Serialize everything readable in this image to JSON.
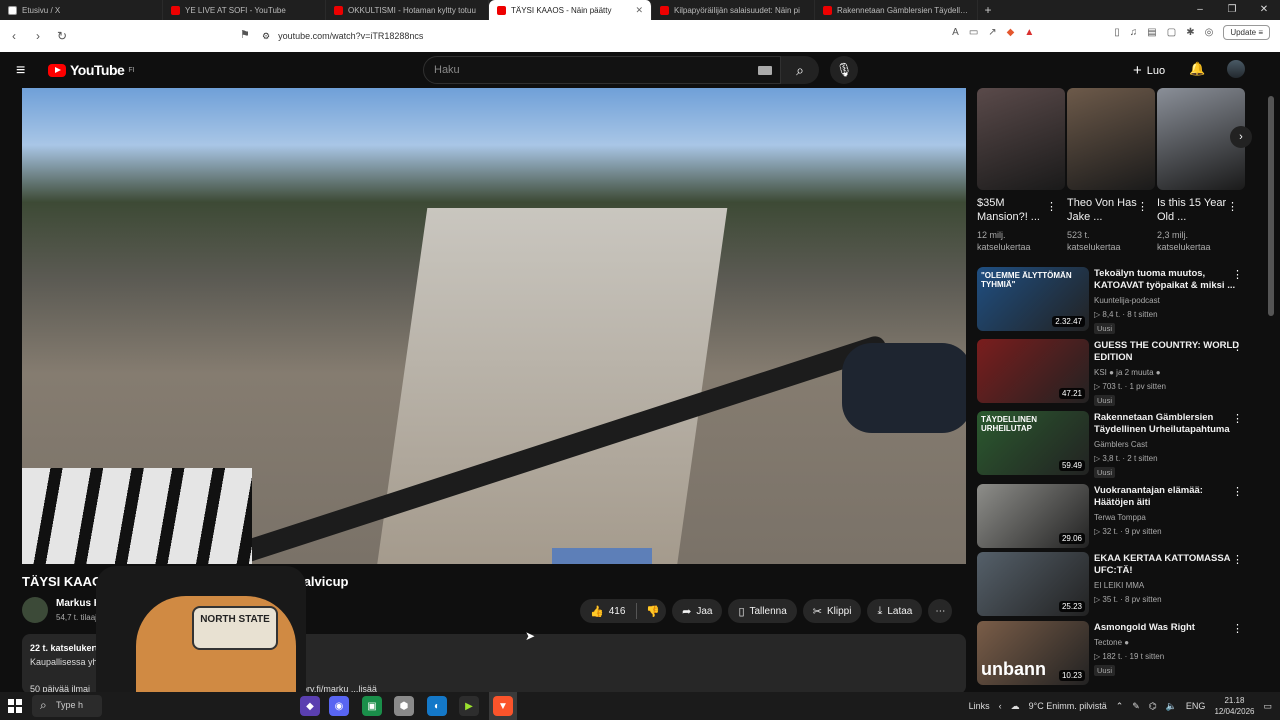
{
  "browser": {
    "tabs": [
      {
        "label": "Etusivu / X",
        "active": false,
        "icon": "x-icon"
      },
      {
        "label": "YE LIVE AT SOFI - YouTube",
        "active": false,
        "icon": "youtube-icon"
      },
      {
        "label": "OKKULTISMI - Hotaman kyltty totuu",
        "active": false,
        "icon": "youtube-icon"
      },
      {
        "label": "TÄYSI KAAOS - Näin päätty",
        "active": true,
        "icon": "youtube-icon"
      },
      {
        "label": "Kilpapyöräilijän salaisuudet: Näin pi",
        "active": false,
        "icon": "youtube-icon"
      },
      {
        "label": "Rakennetaan Gämblersien Täydelline",
        "active": false,
        "icon": "youtube-icon"
      }
    ],
    "new_tab": "+",
    "url": "youtube.com/watch?v=iTR18288ncs",
    "update_label": "Update"
  },
  "yt_header": {
    "logo_text": "YouTube",
    "region": "FI",
    "search_placeholder": "Haku",
    "create_label": "Luo"
  },
  "video": {
    "title_visible_left": "TÄYSI KAAOS - Näin p",
    "title_visible_right": "äilyn talvicup",
    "channel": "Markus Heinon",
    "subscribers": "54,7 t. tilaajaa",
    "likes": "416",
    "share_label": "Jaa",
    "save_label": "Tallenna",
    "clip_label": "Klippi",
    "download_label": "Lataa",
    "desc_views": "22 t. katselukert",
    "desc_line2": "Kaupallisessa yh",
    "desc_line3": "50 päivää ilmai",
    "desc_link": "ory.fi/marku",
    "more_label": "...lisää",
    "cam_badge": "NORTH STATE"
  },
  "shorts": [
    {
      "title": "$35M Mansion?! ...",
      "views": "12 milj. katselukertaa",
      "thumb_color": "#5a4a4a"
    },
    {
      "title": "Theo Von Has Jake ...",
      "views": "523 t. katselukertaa",
      "thumb_color": "#6d5a4a"
    },
    {
      "title": "Is this 15 Year Old ...",
      "views": "2,3 milj. katselukertaa",
      "thumb_color": "#8a8f98"
    }
  ],
  "recommendations": [
    {
      "title": "Tekoälyn tuoma muutos, KATOAVAT työpaikat & miksi ...",
      "channel": "Kuuntelija-podcast",
      "meta": "▷ 8,4 t. · 8 t sitten",
      "badge": "Uusi",
      "duration": "2.32.47",
      "thumb_color": "#1f4f82",
      "thumb_text": "\"OLEMME ÄLYTTÖMÄN TYHMIÄ\""
    },
    {
      "title": "GUESS THE COUNTRY: WORLD EDITION",
      "channel": "KSI ● ja 2 muuta ●",
      "meta": "▷ 703 t. · 1 pv sitten",
      "badge": "Uusi",
      "duration": "47.21",
      "thumb_color": "#7a1d1d",
      "thumb_text": ""
    },
    {
      "title": "Rakennetaan Gämblersien Täydellinen Urheilutapahtuma",
      "channel": "Gämblers Cast",
      "meta": "▷ 3,8 t. · 2 t sitten",
      "badge": "Uusi",
      "duration": "59.49",
      "thumb_color": "#2b5a2f",
      "thumb_text": "TÄYDELLINEN URHEILUTAP"
    },
    {
      "title": "Vuokranantajan elämää: Häätöjen äiti",
      "channel": "Terwa Tomppa",
      "meta": "▷ 32 t. · 9 pv sitten",
      "badge": "",
      "duration": "29.06",
      "thumb_color": "#8e8e8a",
      "thumb_text": ""
    },
    {
      "title": "EKAA KERTAA KATTOMASSA UFC:TÄ!",
      "channel": "EI LEIKI MMA",
      "meta": "▷ 35 t. · 8 pv sitten",
      "badge": "",
      "duration": "25.23",
      "thumb_color": "#55606a",
      "thumb_text": ""
    },
    {
      "title": "Asmongold Was Right",
      "channel": "Tectone ●",
      "meta": "▷ 182 t. · 19 t sitten",
      "badge": "Uusi",
      "duration": "10.23",
      "thumb_color": "#7a5d48",
      "thumb_text": "unbann"
    }
  ],
  "taskbar": {
    "search_placeholder": "Type h",
    "links": "Links",
    "weather": "9°C Enimm. pilvistä",
    "lang": "ENG",
    "time": "21.18",
    "date": "12/04/2026"
  }
}
